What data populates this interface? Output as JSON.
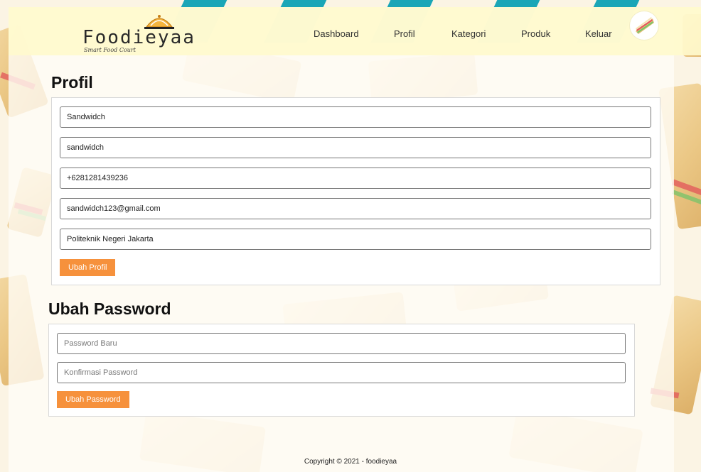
{
  "brand": {
    "name": "Foodieyaa",
    "tagline": "Smart Food Court"
  },
  "nav": {
    "items": [
      "Dashboard",
      "Profil",
      "Kategori",
      "Produk",
      "Keluar"
    ]
  },
  "profile": {
    "title": "Profil",
    "fields": {
      "name": "Sandwidch",
      "username": "sandwidch",
      "phone": "+6281281439236",
      "email": "sandwidch123@gmail.com",
      "address": "Politeknik Negeri Jakarta"
    },
    "submit_label": "Ubah Profil"
  },
  "password": {
    "title": "Ubah Password",
    "new_placeholder": "Password Baru",
    "confirm_placeholder": "Konfirmasi Password",
    "submit_label": "Ubah Password"
  },
  "footer": {
    "copyright": "Copyright © 2021 - foodieyaa"
  },
  "colors": {
    "accent": "#f6913c",
    "header_bg": "#fffacd",
    "stripe": "#1aa6b7"
  },
  "icons": {
    "avatar": "sandwich-avatar-icon",
    "logo": "cloche-icon"
  }
}
